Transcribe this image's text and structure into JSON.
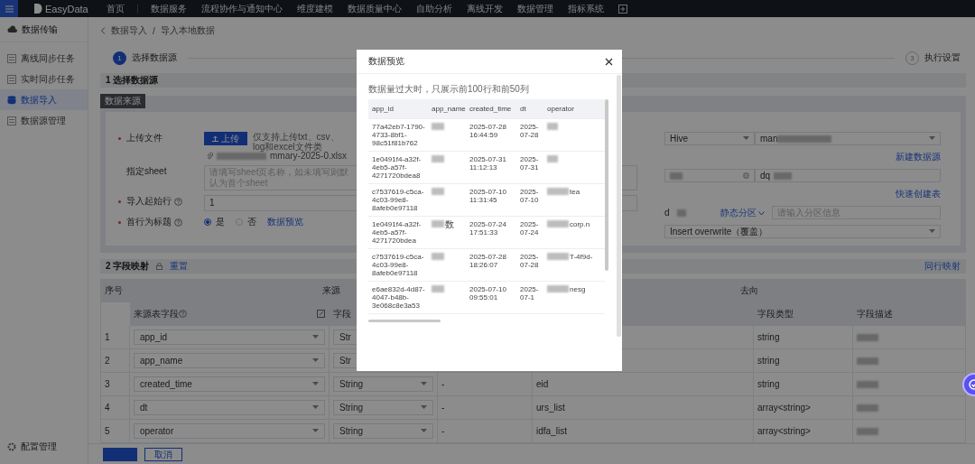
{
  "nav": {
    "logo": "EasyData",
    "items": [
      "首页",
      "数据服务",
      "流程协作与通知中心",
      "维度建模",
      "数据质量中心",
      "自助分析",
      "离线开发",
      "数据管理",
      "指标系统"
    ]
  },
  "sidebar": {
    "title": "数据传输",
    "items": [
      {
        "label": "离线同步任务",
        "selected": false
      },
      {
        "label": "实时同步任务",
        "selected": false
      },
      {
        "label": "数据导入",
        "selected": true
      },
      {
        "label": "数据源管理",
        "selected": false
      }
    ],
    "footer": "配置管理"
  },
  "breadcrumb": {
    "items": [
      "数据导入",
      "导入本地数据"
    ],
    "separator": "/"
  },
  "steps": [
    {
      "number": "1",
      "label": "选择数据源",
      "active": true
    },
    {
      "number": "3",
      "label": "执行设置",
      "active": false
    }
  ],
  "source_section": {
    "title": "1 选择数据源",
    "tag": "数据来源",
    "fields": [
      {
        "kind": "upload",
        "label": "上传文件",
        "required": true,
        "help": false,
        "button": "上传",
        "hint": "仅支持上传txt、csv、log和excel文件类",
        "file": "mmary-2025-0.xlsx"
      },
      {
        "kind": "text",
        "label": "指定sheet",
        "required": false,
        "help": false,
        "placeholder": "请填写sheet页名称，如未填写则默认为首个sheet"
      },
      {
        "kind": "text",
        "label": "导入起始行",
        "required": true,
        "help": true,
        "value": "1"
      },
      {
        "kind": "radio",
        "label": "首行为标题",
        "required": true,
        "help": true,
        "options": [
          {
            "label": "是",
            "selected": true
          },
          {
            "label": "否",
            "selected": false
          }
        ],
        "link": "数据预览"
      }
    ]
  },
  "target": {
    "engine": "Hive",
    "datasource": "man",
    "new_datasource_link": "新建数据源",
    "table": "dq",
    "create_table_link": "快速创建表",
    "partition_field": "d",
    "partition_mode": "静态分区",
    "partition_placeholder": "请输入分区信息",
    "write_mode": "Insert overwrite（覆盖）"
  },
  "mapping": {
    "title": "2 字段映射",
    "reset_link": "重置",
    "same_row_link": "同行映射",
    "groups": [
      "来源",
      "去向"
    ],
    "columns": [
      "序号",
      "来源表字段",
      "字段",
      "字段类型",
      "字段描述"
    ],
    "rows": [
      {
        "number": "1",
        "source_field": "app_id",
        "source_type": "Str",
        "target_type": "string"
      },
      {
        "number": "2",
        "source_field": "app_name",
        "source_type": "Str",
        "target_type": "string"
      },
      {
        "number": "3",
        "source_field": "created_time",
        "source_type": "String",
        "source_desc": "-",
        "target_field": "eid",
        "target_type": "string"
      },
      {
        "number": "4",
        "source_field": "dt",
        "source_type": "String",
        "source_desc": "-",
        "target_field": "urs_list",
        "target_type": "array<string>"
      },
      {
        "number": "5",
        "source_field": "operator",
        "source_type": "String",
        "source_desc": "-",
        "target_field": "idfa_list",
        "target_type": "array<string>"
      }
    ]
  },
  "buttons": [
    {
      "kind": "primary"
    },
    {
      "kind": "default",
      "label": "取消"
    }
  ],
  "preview": {
    "title": "数据预览",
    "note": "数据量过大时，只展示前100行和前50列",
    "columns": [
      "app_id",
      "app_name",
      "created_time",
      "dt",
      "operator"
    ],
    "rows": [
      {
        "app_id": "77a42eb7-1790-4733-8bf1-98c51f81b762",
        "created_time": "2025-07-28 16:44:59",
        "dt": "2025-07-28"
      },
      {
        "app_id": "1e0491f4-a32f-4eb5-a57f-4271720bdea8",
        "created_time": "2025-07-31 11:12:13",
        "dt": "2025-07-31"
      },
      {
        "app_id": "c7537619-c5ca-4c03-99e8-8afeb0e97118",
        "created_time": "2025-07-10 11:31:45",
        "dt": "2025-07-10",
        "operator": "tea"
      },
      {
        "app_id": "1e0491f4-a32f-4eb5-a57f-4271720bdea",
        "app_name": "数",
        "created_time": "2025-07-24 17:51:33",
        "dt": "2025-07-24",
        "operator": "corp.n"
      },
      {
        "app_id": "c7537619-c5ca-4c03-99e8-8afeb0e97118",
        "created_time": "2025-07-28 18:26:07",
        "dt": "2025-07-28",
        "operator": "T-4f9d-"
      },
      {
        "app_id": "e6ae832d-4d87-4047-b48b-3e068c8e3a53",
        "created_time": "2025-07-10 09:55:01",
        "dt": "2025-07-1",
        "operator": "nesg"
      }
    ]
  }
}
